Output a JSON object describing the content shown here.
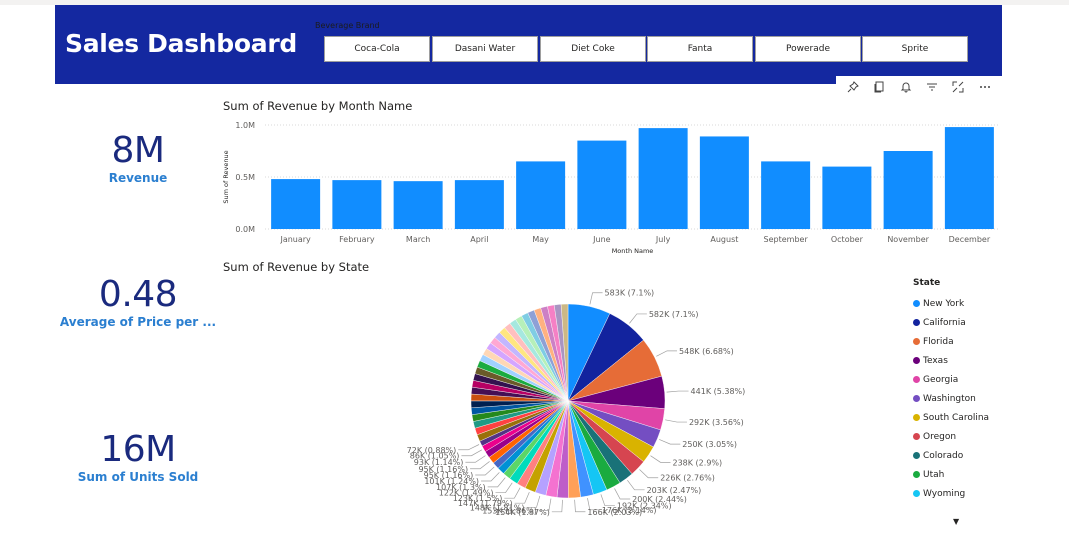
{
  "header": {
    "title": "Sales Dashboard"
  },
  "slicer": {
    "title": "Beverage Brand",
    "options": [
      "Coca-Cola",
      "Dasani Water",
      "Diet Coke",
      "Fanta",
      "Powerade",
      "Sprite"
    ]
  },
  "toolbar": {
    "icons": [
      "pin-icon",
      "copy-icon",
      "bell-icon",
      "filter-icon",
      "focus-mode-icon",
      "more-options-icon"
    ]
  },
  "kpis": [
    {
      "value": "8M",
      "label": "Revenue"
    },
    {
      "value": "0.48",
      "label": "Average of Price per ..."
    },
    {
      "value": "16M",
      "label": "Sum of Units Sold"
    }
  ],
  "colors": {
    "header": "#1428a0",
    "bar": "#118dff",
    "kpi_value": "#1a2a7e",
    "kpi_label": "#2b7fd0"
  },
  "chart_data": [
    {
      "type": "bar",
      "title": "Sum of Revenue by Month Name",
      "xlabel": "Month Name",
      "ylabel": "Sum of Revenue",
      "categories": [
        "January",
        "February",
        "March",
        "April",
        "May",
        "June",
        "July",
        "August",
        "September",
        "October",
        "November",
        "December"
      ],
      "values": [
        0.48,
        0.47,
        0.46,
        0.47,
        0.65,
        0.85,
        0.97,
        0.89,
        0.65,
        0.6,
        0.75,
        0.98
      ],
      "unit": "M",
      "ylim": [
        0,
        1.0
      ],
      "yticks": [
        "0.0M",
        "0.5M",
        "1.0M"
      ],
      "grid": true
    },
    {
      "type": "pie",
      "title": "Sum of Revenue by State",
      "legend_title": "State",
      "legend_position": "right",
      "legend": [
        {
          "name": "New York",
          "color": "#118dff"
        },
        {
          "name": "California",
          "color": "#12239e"
        },
        {
          "name": "Florida",
          "color": "#e66c37"
        },
        {
          "name": "Texas",
          "color": "#6b007b"
        },
        {
          "name": "Georgia",
          "color": "#e044a7"
        },
        {
          "name": "Washington",
          "color": "#744ec2"
        },
        {
          "name": "South Carolina",
          "color": "#d9b300"
        },
        {
          "name": "Oregon",
          "color": "#d64550"
        },
        {
          "name": "Colorado",
          "color": "#197278"
        },
        {
          "name": "Utah",
          "color": "#1aab40"
        },
        {
          "name": "Wyoming",
          "color": "#15c6f4"
        }
      ],
      "slices": [
        {
          "label": "583K (7.1%)",
          "value": 7.1
        },
        {
          "label": "582K (7.1%)",
          "value": 7.1
        },
        {
          "label": "548K (6.68%)",
          "value": 6.68
        },
        {
          "label": "441K (5.38%)",
          "value": 5.38
        },
        {
          "label": "292K (3.56%)",
          "value": 3.56
        },
        {
          "label": "250K (3.05%)",
          "value": 3.05
        },
        {
          "label": "238K (2.9%)",
          "value": 2.9
        },
        {
          "label": "226K (2.76%)",
          "value": 2.76
        },
        {
          "label": "203K (2.47%)",
          "value": 2.47
        },
        {
          "label": "200K (2.44%)",
          "value": 2.44
        },
        {
          "label": "192K (2.34%)",
          "value": 2.34
        },
        {
          "label": "176K (2.14%)",
          "value": 2.14
        },
        {
          "label": "166K (2.03%)",
          "value": 2.03
        },
        {
          "label": "154K (1.87%)",
          "value": 1.87
        },
        {
          "label": "153K (1.86%)",
          "value": 1.86
        },
        {
          "label": "148K (1.81%)",
          "value": 1.81
        },
        {
          "label": "147K (1.79%)",
          "value": 1.79
        },
        {
          "label": "123K (1.5%)",
          "value": 1.5
        },
        {
          "label": "122K (1.49%)",
          "value": 1.49
        },
        {
          "label": "107K (1.3%)",
          "value": 1.3
        },
        {
          "label": "101K (1.24%)",
          "value": 1.24
        },
        {
          "label": "95K (1.16%)",
          "value": 1.16
        },
        {
          "label": "95K (1.16%)",
          "value": 1.16
        },
        {
          "label": "93K (1.14%)",
          "value": 1.14
        },
        {
          "label": "86K (1.05%)",
          "value": 1.05
        },
        {
          "label": "72K (0.88%)",
          "value": 0.88
        }
      ],
      "palette": [
        "#118dff",
        "#12239e",
        "#e66c37",
        "#6b007b",
        "#e044a7",
        "#744ec2",
        "#d9b300",
        "#d64550",
        "#197278",
        "#1aab40",
        "#15c6f4",
        "#4092ff",
        "#ffa058",
        "#be5dc9",
        "#f472d0",
        "#b5a1ff",
        "#c4a200",
        "#ff8080",
        "#00dbbc",
        "#5bd667",
        "#0091d5",
        "#4668c5",
        "#ff6300",
        "#99008a",
        "#ec008c",
        "#533285",
        "#99700a",
        "#ff4141",
        "#1f9a85",
        "#25891c",
        "#0057a2",
        "#002050",
        "#c94f0f",
        "#450f54",
        "#b60064",
        "#34124f",
        "#6a5a29",
        "#1aab40",
        "#a0d1ff",
        "#ffd7b5",
        "#d4a5ff",
        "#ffa8d3",
        "#c2b6ff",
        "#ffe680",
        "#ffbfbf",
        "#a6e8df",
        "#b6f0b9",
        "#7fcde4",
        "#8ea0d6",
        "#ffb180",
        "#cc80c5",
        "#f580c5",
        "#a995c2",
        "#ccb885"
      ]
    }
  ]
}
